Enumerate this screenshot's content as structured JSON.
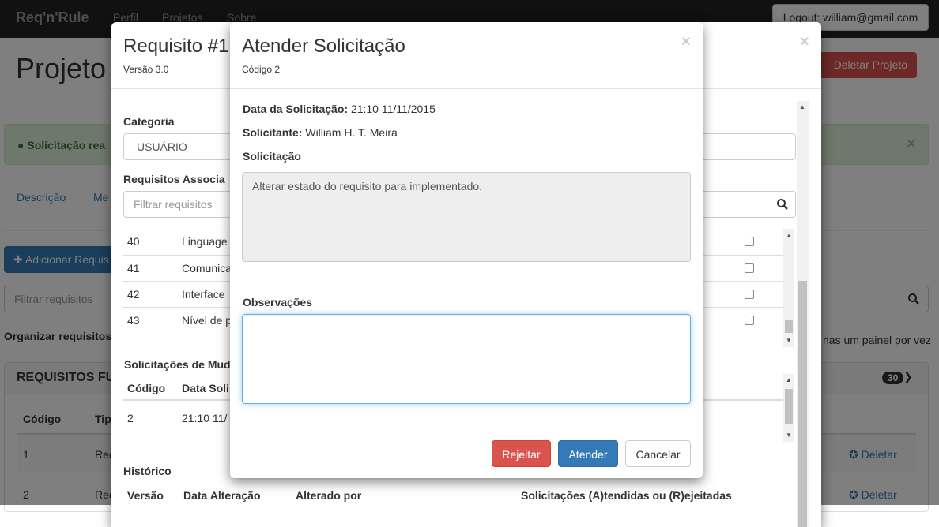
{
  "navbar": {
    "brand": "Req'n'Rule",
    "links": [
      "Perfil",
      "Projetos",
      "Sobre"
    ],
    "logout": "Logout: william@gmail.com"
  },
  "page": {
    "title": "Projeto",
    "delete_project": "Deletar Projeto",
    "alert_text": "Solicitação rea",
    "alert_close": "×",
    "tabs": [
      "Descrição",
      "Me"
    ],
    "add_button": "Adicionar Requis",
    "filter_placeholder": "Filtrar requisitos",
    "organize_label": "Organizar requisitos",
    "one_panel_text": "nas um painel por vez",
    "panel_title": "REQUISITOS FU",
    "panel_badge": "30",
    "panel_headers": [
      "Código",
      "Tip"
    ],
    "panel_rows": [
      {
        "code": "1",
        "type": "Rec",
        "action": "Deletar"
      },
      {
        "code": "2",
        "type": "Rec",
        "action": "Deletar"
      }
    ]
  },
  "back_modal": {
    "title": "Requisito #1",
    "version": "Versão 3.0",
    "close": "×",
    "category_label": "Categoria",
    "category_value": "USUÁRIO",
    "assoc_label": "Requisitos Associa",
    "assoc_filter_placeholder": "Filtrar requisitos",
    "assoc_rows": [
      {
        "num": "40",
        "name": "Linguage"
      },
      {
        "num": "41",
        "name": "Comunica"
      },
      {
        "num": "42",
        "name": "Interface"
      },
      {
        "num": "43",
        "name": "Nível de p"
      }
    ],
    "changes_label": "Solicitações de Mud",
    "changes_headers": [
      "Código",
      "Data Soli"
    ],
    "changes_row": {
      "code": "2",
      "date": "21:10 11/"
    },
    "history_label": "Histórico",
    "history_headers": [
      "Versão",
      "Data Alteração",
      "Alterado por",
      "Solicitações (A)tendidas ou (R)ejeitadas"
    ]
  },
  "modal": {
    "title": "Atender Solicitação",
    "code": "Código 2",
    "close": "×",
    "date_label": "Data da Solicitação:",
    "date_value": "21:10 11/11/2015",
    "requester_label": "Solicitante:",
    "requester_value": "William H. T. Meira",
    "request_label": "Solicitação",
    "request_text": "Alterar estado do requisito para implementado.",
    "observations_label": "Observações",
    "observations_value": "",
    "reject_label": "Rejeitar",
    "attend_label": "Atender",
    "cancel_label": "Cancelar"
  }
}
